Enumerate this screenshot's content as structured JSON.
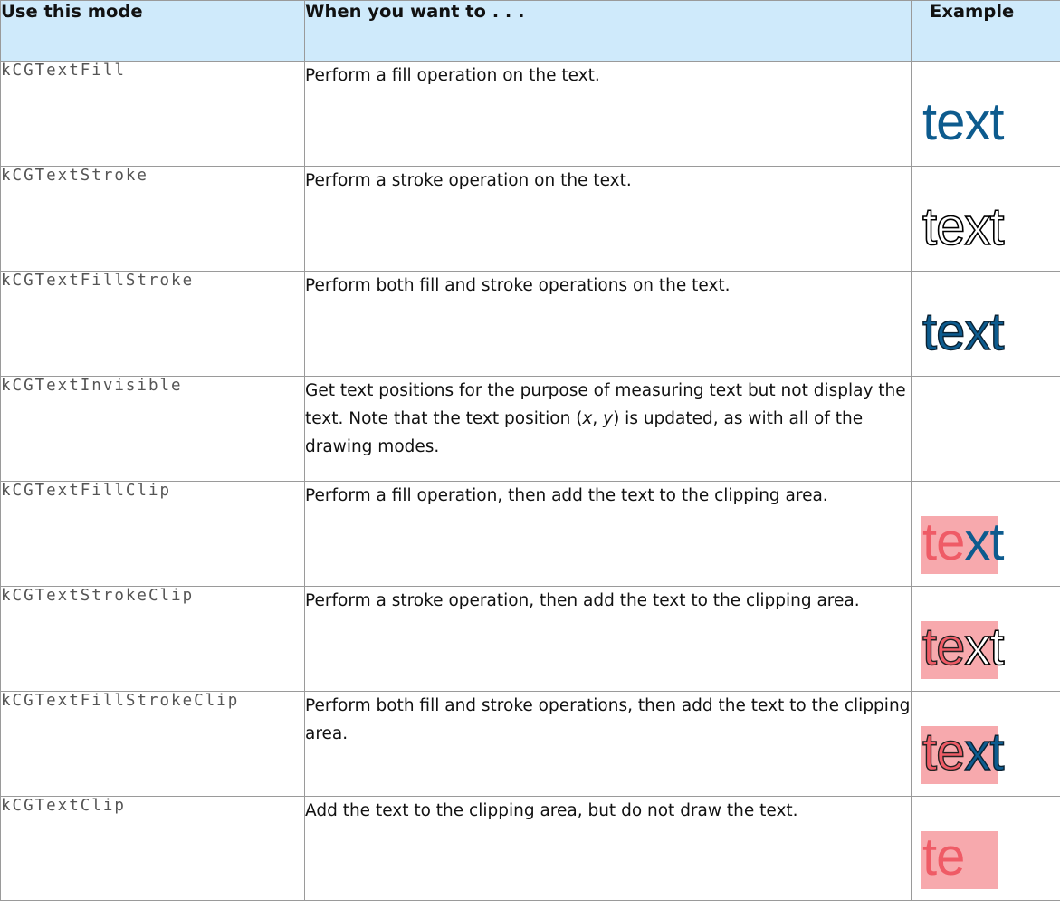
{
  "table": {
    "headers": [
      "Use this mode",
      "When you want to . . .",
      "Example"
    ],
    "rows": [
      {
        "mode": "kCGTextFill",
        "description": "Perform a fill operation on the text.",
        "example": "text",
        "example_style": "fill"
      },
      {
        "mode": "kCGTextStroke",
        "description": "Perform a stroke operation on the text.",
        "example": "text",
        "example_style": "stroke"
      },
      {
        "mode": "kCGTextFillStroke",
        "description": "Perform both fill and stroke operations on the text.",
        "example": "text",
        "example_style": "fill-stroke"
      },
      {
        "mode": "kCGTextInvisible",
        "description_parts": [
          "Get text positions for the purpose of measuring text but not display the text. Note that the text position (",
          "x",
          ", ",
          "y",
          ") is updated, as with all of the drawing modes."
        ],
        "example": "",
        "example_style": "none"
      },
      {
        "mode": "kCGTextFillClip",
        "description": "Perform a fill operation, then add the text to the clipping area.",
        "example_clipped": "te",
        "example_rest": "xt",
        "example_style": "fill-clip"
      },
      {
        "mode": "kCGTextStrokeClip",
        "description": "Perform a stroke operation, then add the text to the clipping area.",
        "example_clipped": "te",
        "example_rest": "xt",
        "example_style": "stroke-clip"
      },
      {
        "mode": "kCGTextFillStrokeClip",
        "description": "Perform both fill and stroke operations, then add the text to the clipping area.",
        "example_clipped": "te",
        "example_rest": "xt",
        "example_style": "fill-stroke-clip"
      },
      {
        "mode": "kCGTextClip",
        "description": "Add the text to the clipping area, but do not draw the text.",
        "example_clipped": "te",
        "example_style": "clip"
      }
    ]
  },
  "colors": {
    "header_background": "#cfeafb",
    "fill_blue": "#0d5b8e",
    "clip_pink": "#f7a9ad",
    "clip_red_text": "#ef5b66",
    "border": "#9a9a9a"
  }
}
